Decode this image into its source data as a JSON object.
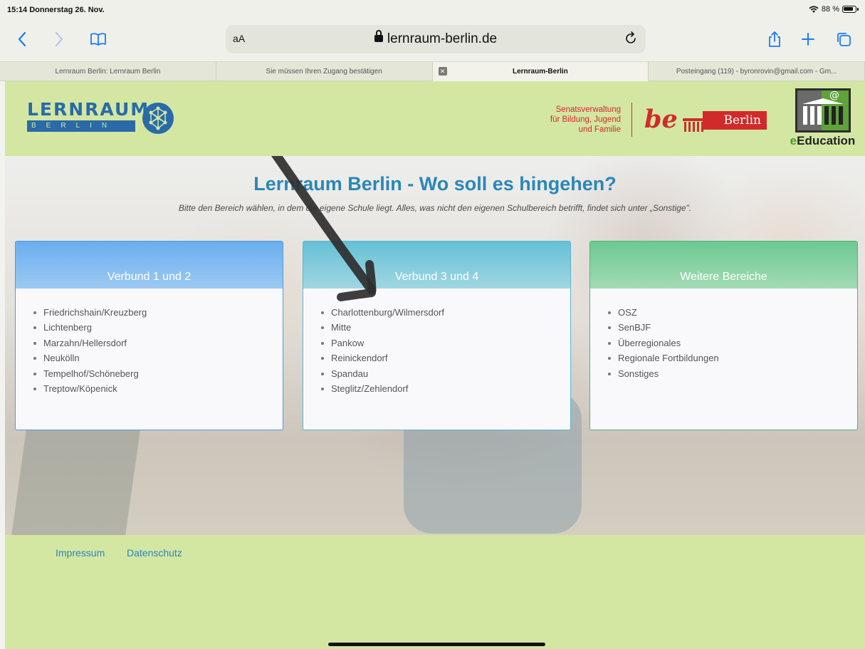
{
  "status_bar": {
    "time_date": "15:14  Donnerstag 26. Nov.",
    "battery": "88 %"
  },
  "toolbar": {
    "text_size_label": "aA",
    "url_host": "lernraum-berlin.de",
    "accent_color": "#1a7aff"
  },
  "tabs": [
    {
      "title": "Lernraum Berlin: Lernraum Berlin",
      "active": false
    },
    {
      "title": "Sie müssen Ihren Zugang bestätigen",
      "active": false
    },
    {
      "title": "Lernraum-Berlin",
      "active": true,
      "icon": "close-icon"
    },
    {
      "title": "Posteingang (119) - byronrovin@gmail.com - Gm...",
      "active": false
    }
  ],
  "site_header": {
    "logo_word": "LERNRAUM",
    "logo_sub": "BERLIN",
    "senat_lines": [
      "Senatsverwaltung",
      "für Bildung, Jugend",
      "und Familie"
    ],
    "be_text": "be",
    "berlin_text": "Berlin",
    "eedu_prefix": "e",
    "eedu_rest": "Education"
  },
  "hero": {
    "title": "Lernraum Berlin - Wo soll es hingehen?",
    "subtitle": "Bitte den Bereich wählen, in dem die eigene Schule liegt. Alles, was nicht den eigenen Schulbereich betrifft, findet sich unter „Sonstige\"."
  },
  "cards": [
    {
      "header": "Verbund 1 und 2",
      "items": [
        "Friedrichshain/Kreuzberg",
        "Lichtenberg",
        "Marzahn/Hellersdorf",
        "Neukölln",
        "Tempelhof/Schöneberg",
        "Treptow/Köpenick"
      ]
    },
    {
      "header": "Verbund 3 und 4",
      "items": [
        "Charlottenburg/Wilmersdorf",
        "Mitte",
        "Pankow",
        "Reinickendorf",
        "Spandau",
        "Steglitz/Zehlendorf"
      ]
    },
    {
      "header": "Weitere Bereiche",
      "items": [
        "OSZ",
        "SenBJF",
        "Überregionales",
        "Regionale Fortbildungen",
        "Sonstiges"
      ]
    }
  ],
  "footer": {
    "impressum": "Impressum",
    "datenschutz": "Datenschutz"
  }
}
